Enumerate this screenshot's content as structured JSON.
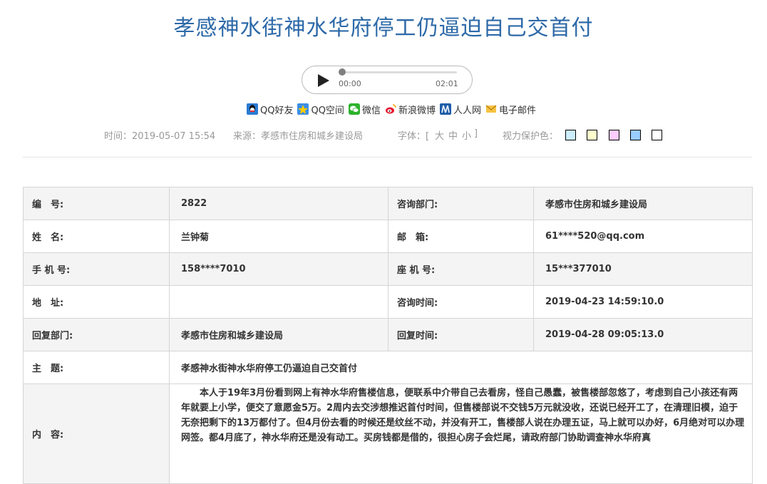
{
  "title": "孝感神水街神水华府停工仍逼迫自己交首付",
  "audio": {
    "current_time": "00:00",
    "total_time": "02:01",
    "progress": 0
  },
  "share": [
    {
      "icon": "qq-icon",
      "label": "QQ好友"
    },
    {
      "icon": "qzone-icon",
      "label": "QQ空间"
    },
    {
      "icon": "wechat-icon",
      "label": "微信"
    },
    {
      "icon": "weibo-icon",
      "label": "新浪微博"
    },
    {
      "icon": "renren-icon",
      "label": "人人网"
    },
    {
      "icon": "email-icon",
      "label": "电子邮件"
    }
  ],
  "meta": {
    "time": "时间：2019-05-07 15:54",
    "source": "来源：孝感市住房和城乡建设局",
    "font_label": "字体：[",
    "font_large": "大",
    "font_medium": "中",
    "font_small": "小",
    "font_close": "]",
    "eye_label": "视力保护色：",
    "eye_colors": [
      "#cceeff",
      "#ffffcc",
      "#ffccff",
      "#99ccff",
      "#ffffff"
    ]
  },
  "table": {
    "row1": {
      "label_a": "编　号:",
      "value_a": "2822",
      "label_b": "咨询部门:",
      "value_b": "孝感市住房和城乡建设局"
    },
    "row2": {
      "label_a": "姓　名:",
      "value_a": "兰钟菊",
      "label_b": "邮　箱:",
      "value_b": "61****520@qq.com"
    },
    "row3": {
      "label_a": "手 机 号:",
      "value_a": "158****7010",
      "label_b": "座 机 号:",
      "value_b": "15***377010"
    },
    "row4": {
      "label_a": "地　址:",
      "value_a": "",
      "label_b": "咨询时间:",
      "value_b": "2019-04-23 14:59:10.0"
    },
    "row5": {
      "label_a": "回复部门:",
      "value_a": "孝感市住房和城乡建设局",
      "label_b": "回复时间:",
      "value_b": "2019-04-28 09:05:13.0"
    },
    "subject": {
      "label": "主　题:",
      "value": "孝感神水街神水华府停工仍逼迫自己交首付"
    },
    "content": {
      "label": "内　容:",
      "value": "本人于19年3月份看到网上有神水华府售楼信息，便联系中介带自己去看房，怪自己愚蠢，被售楼部忽悠了，考虑到自己小孩还有两年就要上小学，便交了意愿金5万。2周内去交涉想推迟首付时间，但售楼部说不交钱5万元就没收，还说已经开工了，在清理旧模，迫于无奈把剩下的13万都付了。但4月份去看的时候还是纹丝不动，并没有开工，售楼部人说在办理五证，马上就可以办好，6月绝对可以办理网签。都4月底了，神水华府还是没有动工。买房钱都是借的，很担心房子会烂尾，请政府部门协助调查神水华府真"
    }
  }
}
